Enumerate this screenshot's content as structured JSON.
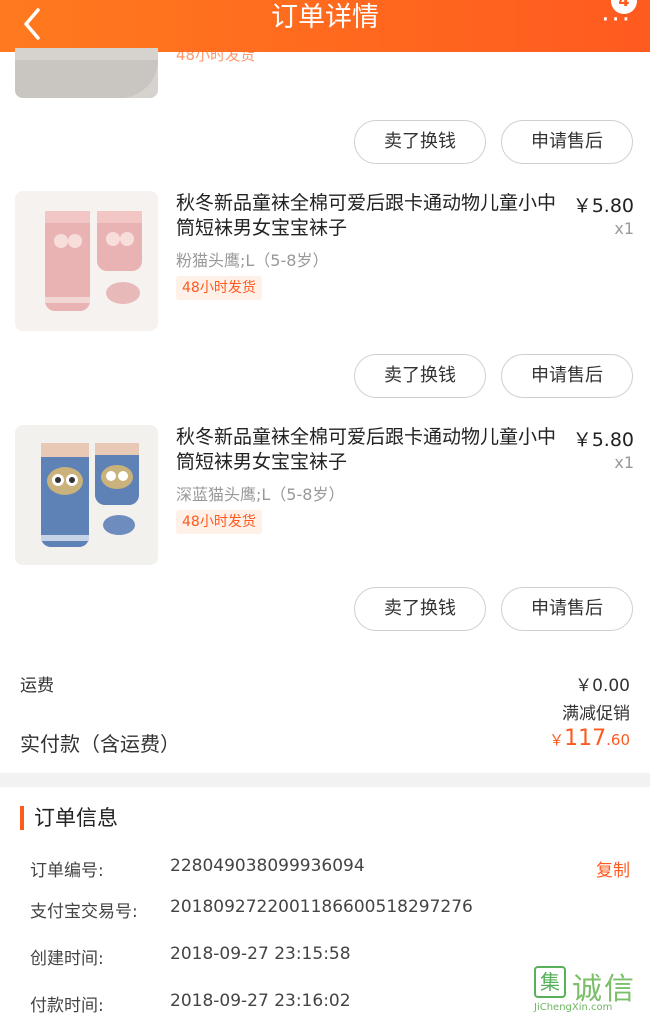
{
  "header": {
    "title": "订单详情",
    "more": "···",
    "badge": "4"
  },
  "top_partial": {
    "tag": "48小时发货"
  },
  "buttons": {
    "sell": "卖了换钱",
    "after_sale": "申请售后"
  },
  "items": [
    {
      "title": "秋冬新品童袜全棉可爱后跟卡通动物儿童小中筒短袜男女宝宝袜子",
      "price": "￥5.80",
      "qty": "x1",
      "spec": "粉猫头鹰;L（5-8岁）",
      "tag": "48小时发货",
      "sock_color": "#e9b3b4"
    },
    {
      "title": "秋冬新品童袜全棉可爱后跟卡通动物儿童小中筒短袜男女宝宝袜子",
      "price": "￥5.80",
      "qty": "x1",
      "spec": "深蓝猫头鹰;L（5-8岁）",
      "tag": "48小时发货",
      "sock_color": "#5f82b6"
    }
  ],
  "summary": {
    "shipping_label": "运费",
    "shipping_value": "￥0.00",
    "promo": "满减促销",
    "paid_label": "实付款（含运费）",
    "paid_currency": "￥",
    "paid_integer": "117",
    "paid_decimal": ".60"
  },
  "order_info": {
    "title": "订单信息",
    "copy": "复制",
    "rows": [
      {
        "label": "订单编号:",
        "value": "2280490380999360​94"
      },
      {
        "label": "支付宝交易号:",
        "value": "2018092722001186600518297276"
      },
      {
        "label": "创建时间:",
        "value": "2018-09-27 23:15:58"
      },
      {
        "label": "付款时间:",
        "value": "2018-09-27 23:16:02"
      }
    ]
  },
  "watermark": {
    "text": "诚信",
    "icon": "集",
    "sub": "JiChengXin.com"
  },
  "colors": {
    "accent": "#ff5a1f",
    "header_start": "#ff7a1e"
  }
}
